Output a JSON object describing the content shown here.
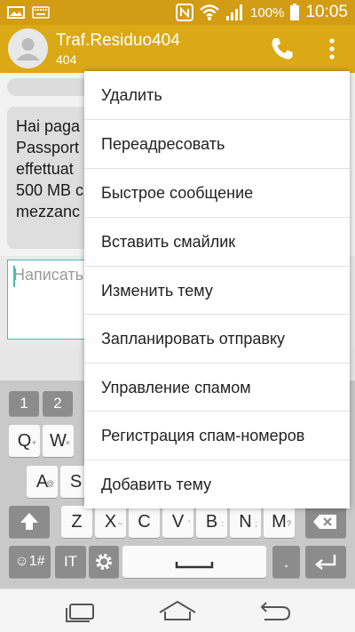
{
  "status_bar": {
    "battery_percent": "100%",
    "time": "10:05",
    "icons": [
      "image-icon",
      "keyboard-icon",
      "nfc-icon",
      "wifi-icon",
      "signal-icon",
      "battery-icon"
    ]
  },
  "header": {
    "contact_name": "Traf.Residuo404",
    "contact_number": "404",
    "icons": [
      "contact-avatar-icon",
      "phone-icon",
      "overflow-menu-icon"
    ]
  },
  "message": {
    "lines": [
      "Hai paga",
      "Passport",
      "effettuat",
      "500 MB c",
      "mezzanc"
    ]
  },
  "compose": {
    "placeholder": "Написать"
  },
  "keyboard": {
    "number_row": [
      "1",
      "2"
    ],
    "row_q": [
      {
        "key": "Q",
        "hint": "+"
      },
      {
        "key": "W",
        "hint": "×"
      }
    ],
    "row_a": [
      {
        "key": "A",
        "hint": "@"
      },
      {
        "key": "S",
        "hint": ""
      }
    ],
    "row_z": [
      {
        "key": "Z",
        "hint": ""
      },
      {
        "key": "X",
        "hint": "~"
      },
      {
        "key": "C",
        "hint": ""
      },
      {
        "key": "V",
        "hint": "'"
      },
      {
        "key": "B",
        "hint": ":"
      },
      {
        "key": "N",
        "hint": ";"
      },
      {
        "key": "M",
        "hint": "?"
      }
    ],
    "bottom_row": {
      "symbols": "☺1#",
      "lang": "IT",
      "period": "."
    },
    "icons": [
      "shift-icon",
      "backspace-icon",
      "settings-icon",
      "space-icon",
      "enter-icon"
    ]
  },
  "menu": {
    "items": [
      "Удалить",
      "Переадресовать",
      "Быстрое сообщение",
      "Вставить смайлик",
      "Изменить тему",
      "Запланировать отправку",
      "Управление спамом",
      "Регистрация спам-номеров",
      "Добавить тему"
    ]
  },
  "nav": {
    "icons": [
      "recent-apps-icon",
      "home-icon",
      "back-icon"
    ]
  },
  "colors": {
    "accent": "#dba916",
    "status_bar": "#d29c14",
    "input_border": "#4cb8b8"
  }
}
